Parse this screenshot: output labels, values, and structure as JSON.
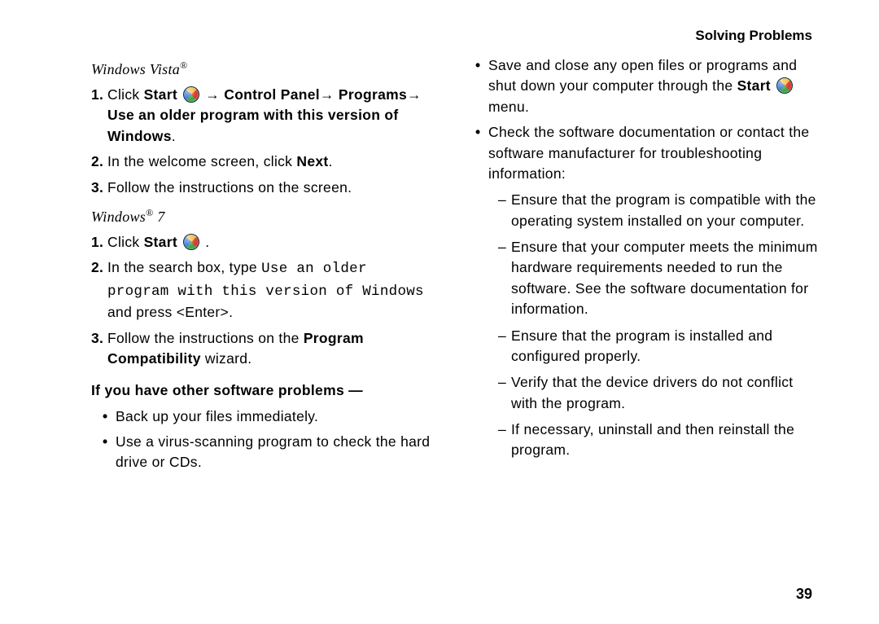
{
  "header": "Solving Problems",
  "page_number": "39",
  "left": {
    "vista_heading_prefix": "Windows Vista",
    "reg_mark": "®",
    "vista_steps": [
      {
        "num": "1.",
        "pre": "Click ",
        "b1": "Start ",
        "mid": " → ",
        "b2": "Control Panel",
        "mid2": "→ ",
        "b3": "Programs",
        "mid3": "→ ",
        "b4": "Use an older program with this version of Windows",
        "post": "."
      },
      {
        "num": "2.",
        "pre": "In the welcome screen, click ",
        "b1": "Next",
        "post": "."
      },
      {
        "num": "3.",
        "pre": "Follow the instructions on the screen."
      }
    ],
    "win7_heading_prefix": "Windows",
    "win7_heading_suffix": " 7",
    "win7_steps": [
      {
        "num": "1.",
        "pre": "Click ",
        "b1": "Start ",
        "post": " ."
      },
      {
        "num": "2.",
        "pre": "In the search box, type ",
        "mono": "Use an older program with this version of Windows",
        "post": " and press <Enter>."
      },
      {
        "num": "3.",
        "pre": "Follow the instructions on the ",
        "b1": "Program Compatibility",
        "post": " wizard."
      }
    ],
    "subhead": "If you have other software problems —",
    "left_bullets": [
      "Back up your files immediately.",
      "Use a virus-scanning program to check the hard drive or CDs."
    ]
  },
  "right": {
    "bullets": [
      {
        "pre": "Save and close any open files or programs and shut down your computer through the ",
        "b1": "Start ",
        "post": " menu."
      },
      {
        "pre": "Check the software documentation or contact the software manufacturer for troubleshooting information:"
      }
    ],
    "dashes": [
      "Ensure that the program is compatible with the operating system installed on your computer.",
      "Ensure that your computer meets the minimum hardware requirements needed to run the software. See the software documentation for information.",
      "Ensure that the program is installed and configured properly.",
      "Verify that the device drivers do not conflict with the program.",
      "If necessary, uninstall and then reinstall the program."
    ]
  }
}
